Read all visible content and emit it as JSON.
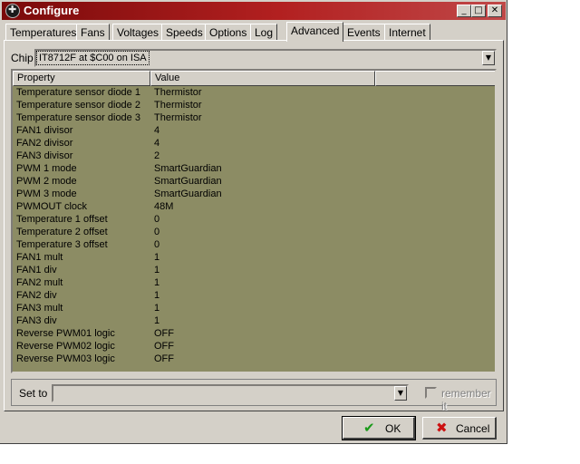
{
  "window": {
    "title": "Configure",
    "min_glyph": "_",
    "max_glyph": "□",
    "close_glyph": "✕",
    "app_icon": "fan-icon"
  },
  "tabs": [
    {
      "label": "Temperatures"
    },
    {
      "label": "Fans"
    },
    {
      "label": "Voltages"
    },
    {
      "label": "Speeds"
    },
    {
      "label": "Options"
    },
    {
      "label": "Log"
    },
    {
      "label": "Advanced",
      "active": true
    },
    {
      "label": "Events"
    },
    {
      "label": "Internet"
    }
  ],
  "chip": {
    "label": "Chip",
    "value": "IT8712F at $C00 on ISA",
    "dropdown_glyph": "▼"
  },
  "grid": {
    "columns": [
      "Property",
      "Value"
    ],
    "background": "#8c8c64",
    "rows": [
      {
        "property": "Temperature sensor diode 1",
        "value": "Thermistor"
      },
      {
        "property": "Temperature sensor diode 2",
        "value": "Thermistor"
      },
      {
        "property": "Temperature sensor diode 3",
        "value": "Thermistor"
      },
      {
        "property": "FAN1 divisor",
        "value": "4"
      },
      {
        "property": "FAN2 divisor",
        "value": "4"
      },
      {
        "property": "FAN3 divisor",
        "value": "2"
      },
      {
        "property": "PWM 1 mode",
        "value": "SmartGuardian"
      },
      {
        "property": "PWM 2 mode",
        "value": "SmartGuardian"
      },
      {
        "property": "PWM 3 mode",
        "value": "SmartGuardian"
      },
      {
        "property": "PWMOUT clock",
        "value": "48M"
      },
      {
        "property": "Temperature 1 offset",
        "value": "0"
      },
      {
        "property": "Temperature 2 offset",
        "value": "0"
      },
      {
        "property": "Temperature 3 offset",
        "value": "0"
      },
      {
        "property": "FAN1 mult",
        "value": "1"
      },
      {
        "property": "FAN1 div",
        "value": "1"
      },
      {
        "property": "FAN2 mult",
        "value": "1"
      },
      {
        "property": "FAN2 div",
        "value": "1"
      },
      {
        "property": "FAN3 mult",
        "value": "1"
      },
      {
        "property": "FAN3 div",
        "value": "1"
      },
      {
        "property": "Reverse PWM01 logic",
        "value": "OFF"
      },
      {
        "property": "Reverse PWM02 logic",
        "value": "OFF"
      },
      {
        "property": "Reverse PWM03 logic",
        "value": "OFF"
      }
    ]
  },
  "set_to": {
    "label": "Set to",
    "value": "",
    "dropdown_glyph": "▼",
    "remember_label": "remember it",
    "remember_checked": false
  },
  "buttons": {
    "ok_label": "OK",
    "ok_icon": "checkmark-icon",
    "ok_glyph": "✔",
    "ok_color": "#1a9a1a",
    "cancel_label": "Cancel",
    "cancel_icon": "x-icon",
    "cancel_glyph": "✖",
    "cancel_color": "#cc1111"
  }
}
